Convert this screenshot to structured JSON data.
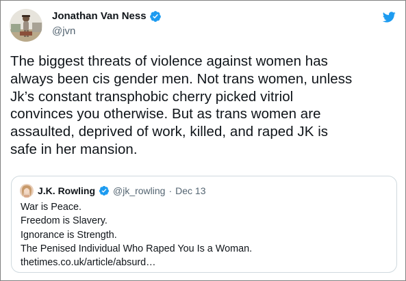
{
  "tweet": {
    "author": {
      "name": "Jonathan Van Ness",
      "handle": "@jvn",
      "verified": true,
      "avatar_icon": "user-avatar-photo"
    },
    "logo_icon": "twitter-bird-icon",
    "text_lines": [
      "The biggest threats of violence against women has",
      "always been cis gender men. Not trans women, unless",
      "Jk’s constant transphobic cherry picked vitriol",
      "convinces you otherwise. But as trans women are",
      "assaulted, deprived of work, killed, and raped JK is",
      "safe in her mansion."
    ]
  },
  "quoted_tweet": {
    "author": {
      "name": "J.K. Rowling",
      "handle": "@jk_rowling",
      "verified": true
    },
    "separator": "·",
    "date": "Dec 13",
    "text_lines": [
      "War is Peace.",
      "Freedom is Slavery.",
      "Ignorance is Strength.",
      "The Penised Individual Who Raped You Is a Woman.",
      "thetimes.co.uk/article/absurd…"
    ]
  },
  "colors": {
    "verified_blue": "#1d9bf0",
    "secondary_text": "#536471",
    "primary_text": "#0f1419",
    "quote_border": "#cfd9de"
  }
}
